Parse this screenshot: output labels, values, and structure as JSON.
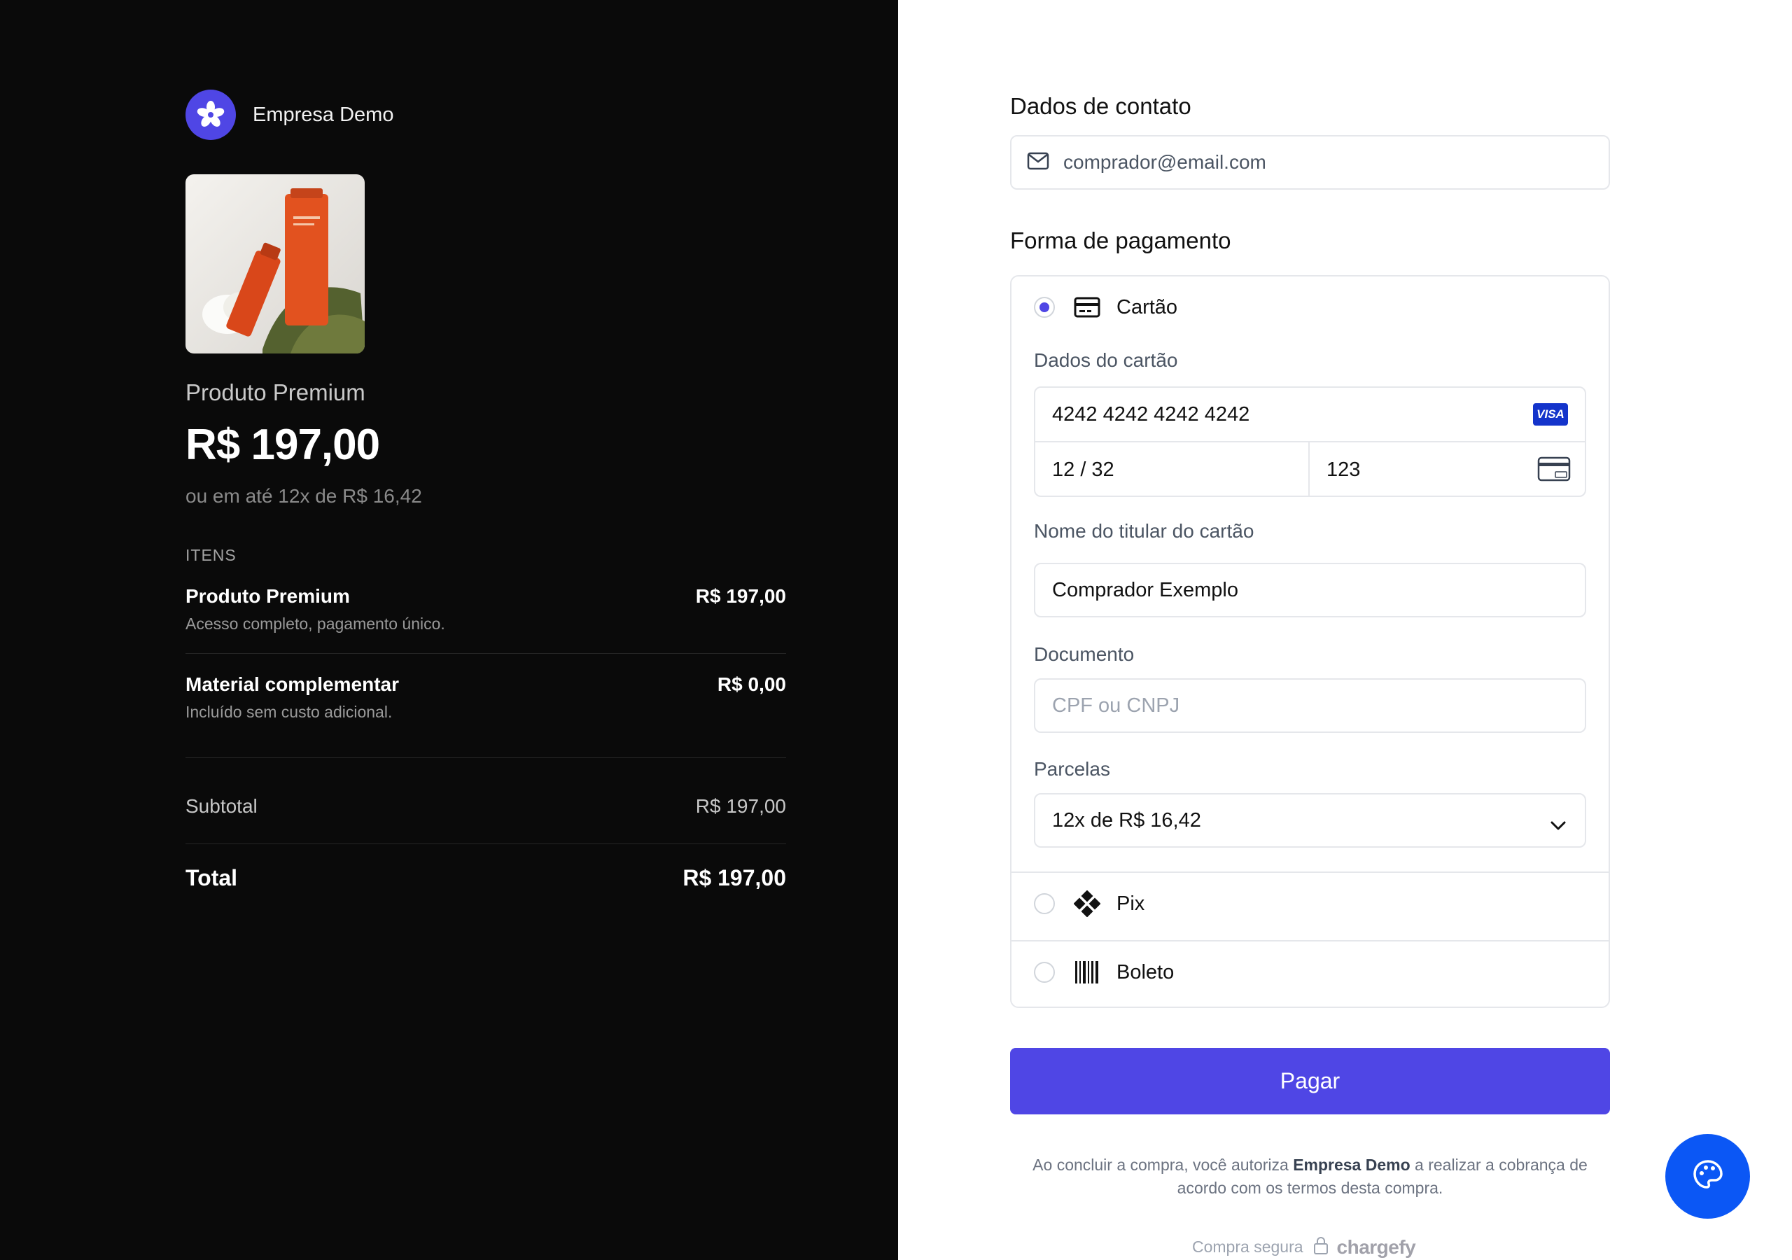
{
  "summary": {
    "brand_name": "Empresa Demo",
    "product_name": "Produto Premium",
    "price": "R$ 197,00",
    "installments_text": "ou em até 12x de R$ 16,42",
    "items_label": "ITENS",
    "items": [
      {
        "title": "Produto Premium",
        "price": "R$ 197,00",
        "desc": "Acesso completo, pagamento único."
      },
      {
        "title": "Material complementar",
        "price": "R$ 0,00",
        "desc": "Incluído sem custo adicional."
      }
    ],
    "subtotal_label": "Subtotal",
    "subtotal_value": "R$ 197,00",
    "total_label": "Total",
    "total_value": "R$ 197,00"
  },
  "contact": {
    "title": "Dados de contato",
    "email": "comprador@email.com"
  },
  "payment": {
    "title": "Forma de pagamento",
    "options": [
      {
        "label": "Cartão",
        "selected": true,
        "icon": "credit-card-icon"
      },
      {
        "label": "Pix",
        "selected": false,
        "icon": "pix-icon"
      },
      {
        "label": "Boleto",
        "selected": false,
        "icon": "barcode-icon"
      }
    ],
    "card_label": "Dados do cartão",
    "card_number": "4242 4242 4242 4242",
    "card_brand": "VISA",
    "card_expiry": "12 / 32",
    "card_cvc": "123",
    "holder_label": "Nome do titular do cartão",
    "holder_value": "Comprador Exemplo",
    "document_label": "Documento",
    "document_placeholder": "CPF ou CNPJ",
    "installments_label": "Parcelas",
    "installments_value": "12x de R$ 16,42"
  },
  "pay_button": "Pagar",
  "legal": {
    "before": "Ao concluir a compra, você autoriza ",
    "company": "Empresa Demo",
    "after": " a realizar a cobrança de acordo com os termos desta compra."
  },
  "secure": {
    "text": "Compra segura",
    "brand": "chargefy"
  },
  "colors": {
    "accent": "#4f46e5",
    "left_bg": "#0a0a0a",
    "fab": "#0b57f5"
  }
}
